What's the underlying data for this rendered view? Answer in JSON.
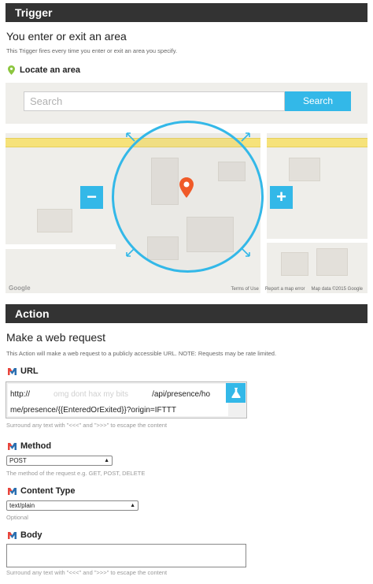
{
  "trigger": {
    "section_title": "Trigger",
    "heading": "You enter or exit an area",
    "description": "This Trigger fires every time you enter or exit an area you specify.",
    "locate_label": "Locate an area",
    "map": {
      "search_placeholder": "Search",
      "search_button": "Search",
      "zoom_out": "−",
      "zoom_in": "+",
      "footer_terms": "Terms of Use",
      "footer_report": "Report a map error",
      "footer_copyright": "Map data ©2015 Google",
      "logo": "Google",
      "pin_color": "#f05a28",
      "accent_color": "#33b8e8"
    }
  },
  "action": {
    "section_title": "Action",
    "heading": "Make a web request",
    "description": "This Action will make a web request to a publicly accessible URL. NOTE: Requests may be rate limited.",
    "url": {
      "label": "URL",
      "value_prefix": "http://",
      "value_redacted": "omg dont hax my bits",
      "value_rest_line1": "/api/presence/ho",
      "value_line2": "me/presence/{{EnteredOrExited}}?origin=IFTTT",
      "helper": "Surround any text with \"<<<\" and \">>>\" to escape the content"
    },
    "method": {
      "label": "Method",
      "selected": "POST",
      "helper": "The method of the request e.g. GET, POST, DELETE"
    },
    "content_type": {
      "label": "Content Type",
      "selected": "text/plain",
      "helper": "Optional"
    },
    "body": {
      "label": "Body",
      "value": "",
      "helper": "Surround any text with \"<<<\" and \">>>\" to escape the content"
    }
  }
}
